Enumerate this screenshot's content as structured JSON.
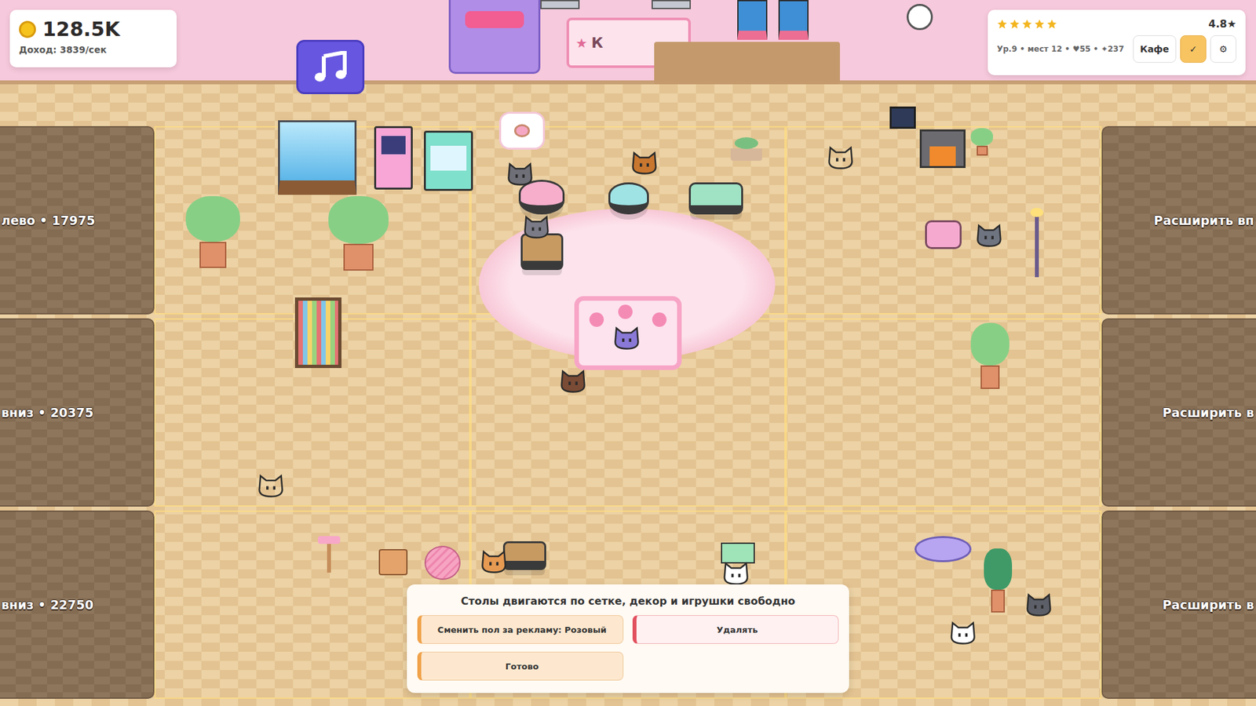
{
  "balance": {
    "coins": "128.5K",
    "income": "Доход: 3839/сек"
  },
  "rating": {
    "stars": 5,
    "score": "4.8★",
    "stats": "Ур.9 • мест 12 • ♥55 • ✦237",
    "buttons": [
      {
        "label": "Кафе",
        "selected": false
      },
      {
        "label": "✓",
        "selected": true
      },
      {
        "label": "⚙",
        "selected": false
      }
    ]
  },
  "wall_sign": {
    "icon": "★",
    "text": "К"
  },
  "expansions_left": [
    {
      "label": "лево • 17975"
    },
    {
      "label": "вниз • 20375"
    },
    {
      "label": "вниз • 22750"
    }
  ],
  "expansions_right": [
    {
      "label": "Расширить вп"
    },
    {
      "label": "Расширить в"
    },
    {
      "label": "Расширить в"
    }
  ],
  "edit_panel": {
    "title": "Столы двигаются по сетке, декор и игрушки свободно",
    "buttons": [
      {
        "label": "Сменить пол за рекламу: Розовый",
        "kind": "primary"
      },
      {
        "label": "Удалять",
        "kind": "danger"
      },
      {
        "label": "Готово",
        "kind": "primary"
      }
    ]
  }
}
